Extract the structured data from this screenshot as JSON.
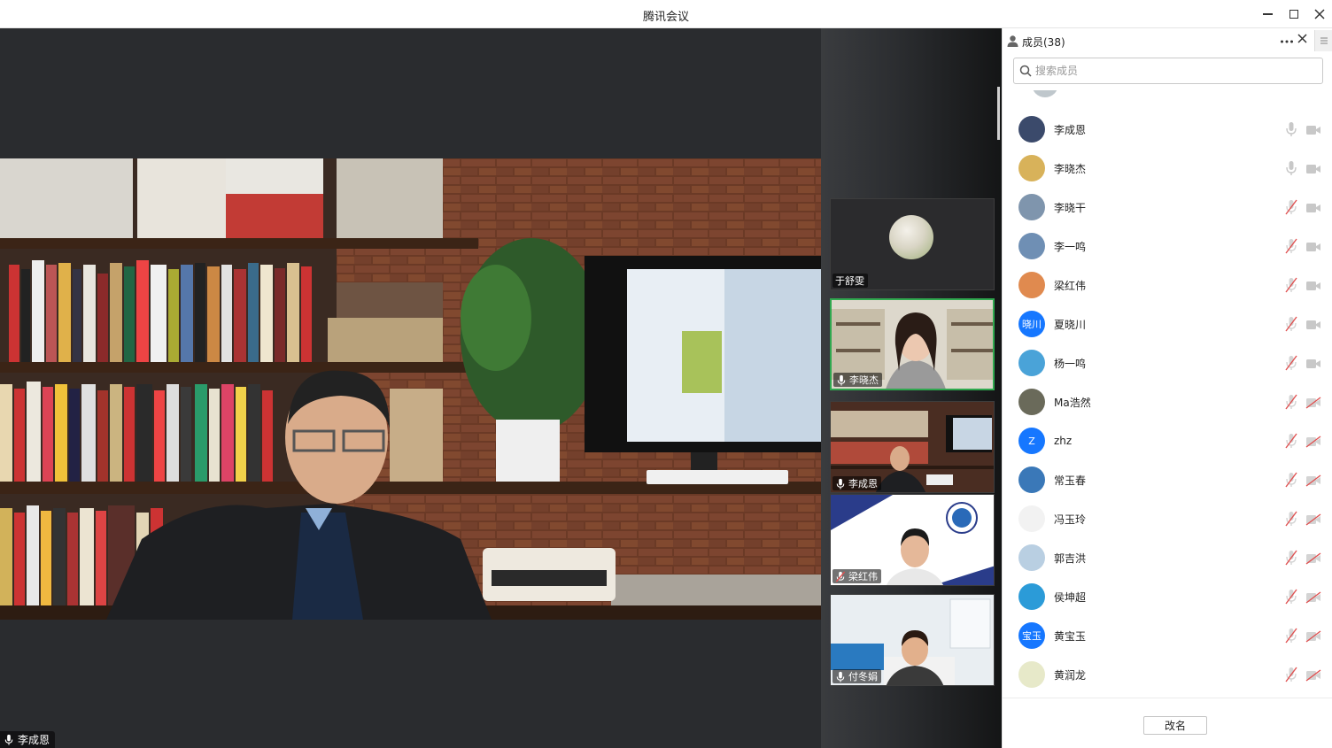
{
  "window": {
    "title": "腾讯会议"
  },
  "main_video": {
    "speaker_name": "李成恩"
  },
  "thumbnails": [
    {
      "name": "于舒雯",
      "type": "avatar"
    },
    {
      "name": "李晓杰",
      "type": "video",
      "active": true
    },
    {
      "name": "李成恩",
      "type": "video"
    },
    {
      "name": "梁红伟",
      "type": "video",
      "muted": true
    },
    {
      "name": "付冬娟",
      "type": "video"
    }
  ],
  "members_panel": {
    "title": "成员(38)",
    "search_placeholder": "搜索成员",
    "rename_label": "改名",
    "members": [
      {
        "name": "李成恩",
        "avatar_color": "#3b4a6b",
        "mic": "on",
        "cam": "on"
      },
      {
        "name": "李晓杰",
        "avatar_color": "#d8b25a",
        "mic": "on",
        "cam": "on"
      },
      {
        "name": "李晓干",
        "avatar_color": "#7f95ad",
        "mic": "off",
        "cam": "on"
      },
      {
        "name": "李一鸣",
        "avatar_color": "#6f8fb4",
        "mic": "off",
        "cam": "on"
      },
      {
        "name": "梁红伟",
        "avatar_color": "#e08a4f",
        "mic": "off",
        "cam": "on"
      },
      {
        "name": "夏晓川",
        "avatar_text": "晓川",
        "avatar_color": "#1677ff",
        "mic": "off",
        "cam": "on"
      },
      {
        "name": "杨一鸣",
        "avatar_color": "#4aa3d8",
        "mic": "off",
        "cam": "on"
      },
      {
        "name": "Ma浩然",
        "avatar_color": "#6a6a5a",
        "mic": "off",
        "cam": "off"
      },
      {
        "name": "zhz",
        "avatar_text": "Z",
        "avatar_color": "#1677ff",
        "mic": "off",
        "cam": "off"
      },
      {
        "name": "常玉春",
        "avatar_color": "#3a78b8",
        "mic": "off",
        "cam": "off"
      },
      {
        "name": "冯玉玲",
        "avatar_color": "#f2f2f2",
        "mic": "off",
        "cam": "off"
      },
      {
        "name": "郭吉洪",
        "avatar_color": "#b9cfe2",
        "mic": "off",
        "cam": "off"
      },
      {
        "name": "侯坤超",
        "avatar_color": "#2b9bd8",
        "mic": "off",
        "cam": "off"
      },
      {
        "name": "黄宝玉",
        "avatar_text": "宝玉",
        "avatar_color": "#1677ff",
        "mic": "off",
        "cam": "off"
      },
      {
        "name": "黄润龙",
        "avatar_color": "#e7e9c9",
        "mic": "off",
        "cam": "off"
      }
    ]
  },
  "colors": {
    "active_border": "#2fa84f",
    "accent_blue": "#1677ff",
    "muted_red": "#e05050"
  }
}
